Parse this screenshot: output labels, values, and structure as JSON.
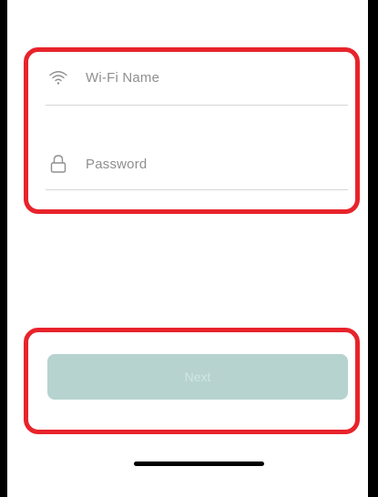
{
  "form": {
    "wifi_name_placeholder": "Wi-Fi Name",
    "password_placeholder": "Password"
  },
  "actions": {
    "next_label": "Next"
  },
  "icons": {
    "wifi": "wifi-icon",
    "lock": "lock-icon"
  },
  "colors": {
    "highlight": "#e8232b",
    "next_button_bg": "#b6d3cf",
    "next_button_text": "#d2e6e3",
    "placeholder_text": "#8f8f8f"
  }
}
